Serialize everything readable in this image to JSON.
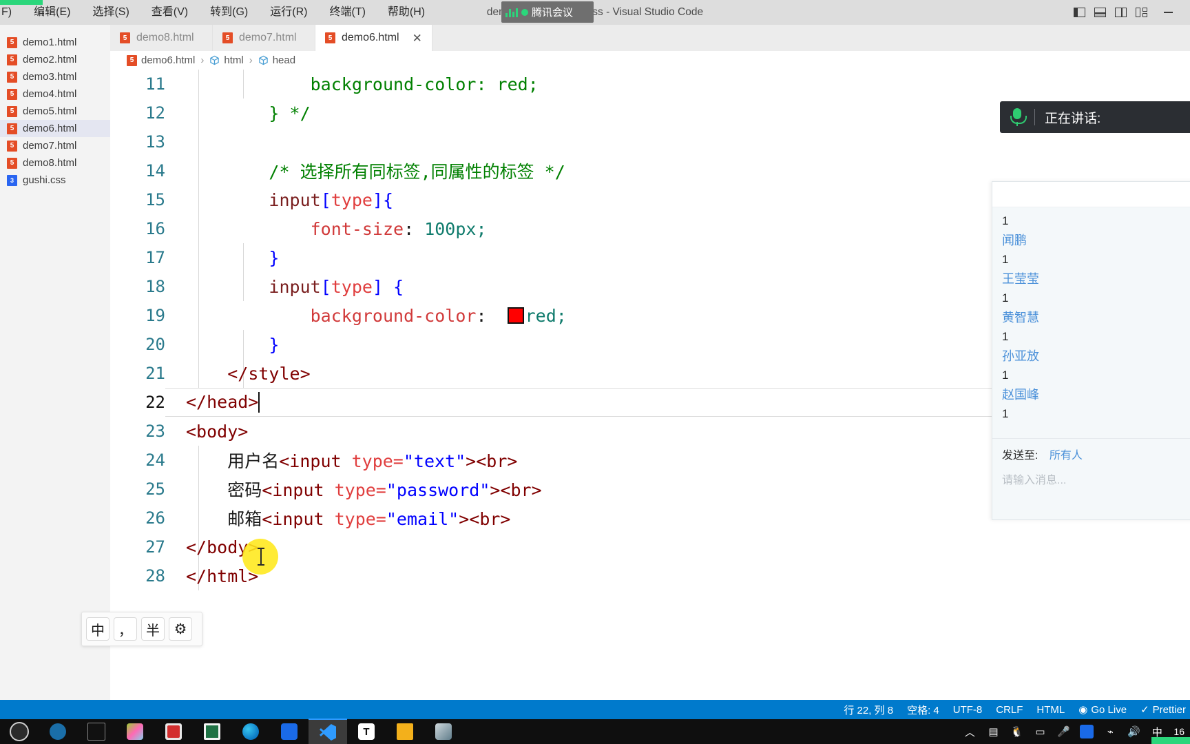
{
  "window": {
    "title": "demo6.html - day51_css - Visual Studio Code",
    "menu": [
      "F)",
      "编辑(E)",
      "选择(S)",
      "查看(V)",
      "转到(G)",
      "运行(R)",
      "终端(T)",
      "帮助(H)"
    ],
    "overlay_app": "腾讯会议",
    "minimize_label": "—"
  },
  "sidebar": {
    "files": [
      {
        "name": "demo1.html",
        "type": "html",
        "selected": false
      },
      {
        "name": "demo2.html",
        "type": "html",
        "selected": false
      },
      {
        "name": "demo3.html",
        "type": "html",
        "selected": false
      },
      {
        "name": "demo4.html",
        "type": "html",
        "selected": false
      },
      {
        "name": "demo5.html",
        "type": "html",
        "selected": false
      },
      {
        "name": "demo6.html",
        "type": "html",
        "selected": true
      },
      {
        "name": "demo7.html",
        "type": "html",
        "selected": false
      },
      {
        "name": "demo8.html",
        "type": "html",
        "selected": false
      },
      {
        "name": "gushi.css",
        "type": "css",
        "selected": false
      }
    ]
  },
  "tabs": [
    {
      "label": "demo8.html",
      "active": false
    },
    {
      "label": "demo7.html",
      "active": false
    },
    {
      "label": "demo6.html",
      "active": true,
      "close": "✕"
    }
  ],
  "breadcrumb": {
    "file": "demo6.html",
    "sep": "›",
    "nodes": [
      "html",
      "head"
    ]
  },
  "editor": {
    "lines": [
      {
        "no": "11",
        "indent": 3,
        "current": false
      },
      {
        "no": "12",
        "indent": 2,
        "current": false
      },
      {
        "no": "13",
        "indent": 0,
        "current": false
      },
      {
        "no": "14",
        "indent": 2,
        "current": false
      },
      {
        "no": "15",
        "indent": 2,
        "current": false
      },
      {
        "no": "16",
        "indent": 3,
        "current": false
      },
      {
        "no": "17",
        "indent": 2,
        "current": false
      },
      {
        "no": "18",
        "indent": 2,
        "current": false
      },
      {
        "no": "19",
        "indent": 3,
        "current": false
      },
      {
        "no": "20",
        "indent": 2,
        "current": false
      },
      {
        "no": "21",
        "indent": 2,
        "current": false
      },
      {
        "no": "22",
        "indent": 1,
        "current": true
      },
      {
        "no": "23",
        "indent": 1,
        "current": false
      },
      {
        "no": "24",
        "indent": 2,
        "current": false
      },
      {
        "no": "25",
        "indent": 2,
        "current": false
      },
      {
        "no": "26",
        "indent": 2,
        "current": false
      },
      {
        "no": "27",
        "indent": 1,
        "current": false
      },
      {
        "no": "28",
        "indent": 1,
        "current": false
      }
    ],
    "code": {
      "l11": "background-color: red;",
      "l12": "} */",
      "l13": "",
      "l14": "/* 选择所有同标签,同属性的标签 */",
      "l15_sel": "input",
      "l15_br1": "[",
      "l15_attr": "type",
      "l15_br2": "]",
      "l15_brace": "{",
      "l16_prop": "font-size",
      "l16_colon": ": ",
      "l16_val": "100px;",
      "l17": "}",
      "l18_sel": "input",
      "l18_br1": "[",
      "l18_attr": "type",
      "l18_br2": "] ",
      "l18_brace": "{",
      "l19_prop": "background-color",
      "l19_colon": ":  ",
      "l19_val": "red;",
      "l20": "}",
      "l21": "</style>",
      "l22": "</head>",
      "l23": "<body>",
      "l24_text": "用户名",
      "l24_tag1": "<input",
      "l24_attr": " type=",
      "l24_val": "\"text\"",
      "l24_tag2": "><br>",
      "l25_text": "密码",
      "l25_tag1": "<input",
      "l25_attr": " type=",
      "l25_val": "\"password\"",
      "l25_tag2": "><br>",
      "l26_text": "邮箱",
      "l26_tag1": "<input",
      "l26_attr": " type=",
      "l26_val": "\"email\"",
      "l26_tag2": "><br>",
      "l27": "</body>",
      "l28": "</html>"
    },
    "color_swatch": "#ff0000"
  },
  "meeting": {
    "speaking_label": "正在讲话:",
    "chat_items": [
      {
        "count": "1",
        "name": "闻鹏"
      },
      {
        "count": "1",
        "name": "王莹莹"
      },
      {
        "count": "1",
        "name": "黄智慧"
      },
      {
        "count": "1",
        "name": "孙亚放"
      },
      {
        "count": "1",
        "name": "赵国峰"
      },
      {
        "count": "1",
        "name": ""
      }
    ],
    "send_to_label": "发送至:",
    "send_to_value": "所有人",
    "message_placeholder": "请输入消息..."
  },
  "ime": {
    "lang_key": "中",
    "punct_key": "，",
    "width_key": "半",
    "settings_key": "⚙"
  },
  "statusbar": {
    "position": "行 22, 列 8",
    "indent": "空格: 4",
    "encoding": "UTF-8",
    "eol": "CRLF",
    "language": "HTML",
    "golive": "Go Live",
    "prettier": "Prettier"
  },
  "taskbar": {
    "tray_lang": "中",
    "tray_time": "16"
  },
  "colors": {
    "accent": "#007acc",
    "html_icon": "#e44d26",
    "css_icon": "#2965f1",
    "comment": "#008000",
    "tag": "#800000",
    "attr_value": "#0000ff",
    "property": "#d13a3a",
    "meeting_green": "#2bd67b",
    "click_highlight": "#ffe81a"
  }
}
